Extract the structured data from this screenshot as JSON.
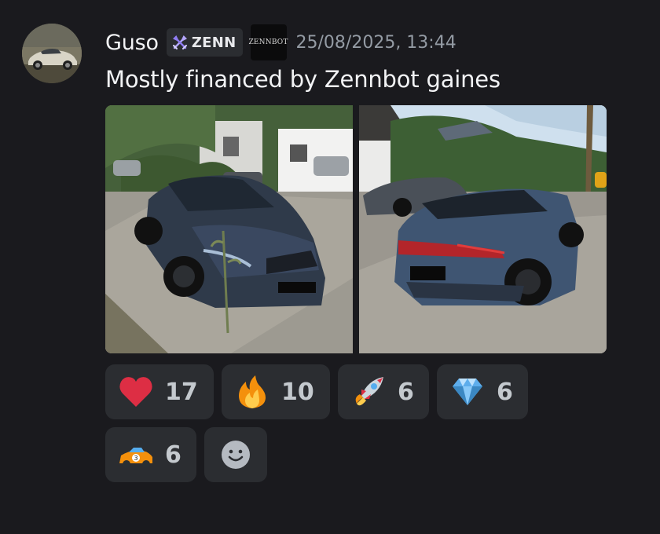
{
  "message": {
    "author": "Guso",
    "tag": "ZENN",
    "bot_badge_text": "ZENNBOT",
    "timestamp": "25/08/2025, 13:44",
    "content": "Mostly financed by Zennbot gaines",
    "attachments": [
      {
        "icon": "car-photo-front"
      },
      {
        "icon": "car-photo-rear"
      }
    ]
  },
  "reactions": [
    {
      "emoji": "heart",
      "count": "17"
    },
    {
      "emoji": "fire",
      "count": "10"
    },
    {
      "emoji": "rocket",
      "count": "6"
    },
    {
      "emoji": "gem",
      "count": "6"
    },
    {
      "emoji": "race-car",
      "count": "6"
    }
  ],
  "add_reaction": {
    "icon": "smiley-icon"
  },
  "colors": {
    "background": "#1a1a1e",
    "chip": "#2b2d31",
    "text": "#f2f3f5",
    "muted": "#949ba4"
  }
}
